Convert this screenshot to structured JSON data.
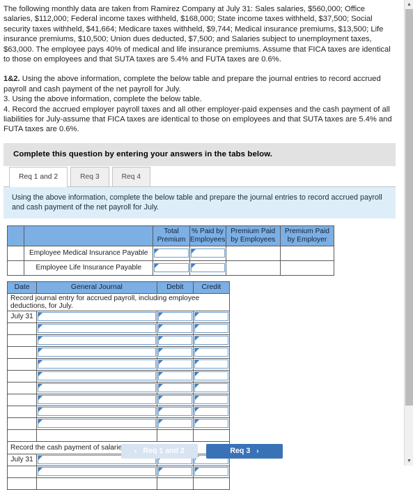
{
  "problem": {
    "paragraph": "The following monthly data are taken from Ramirez Company at July 31: Sales salaries, $560,000; Office salaries, $112,000; Federal income taxes withheld, $168,000; State income taxes withheld, $37,500; Social security taxes withheld, $41,664; Medicare taxes withheld, $9,744; Medical insurance premiums, $13,500; Life insurance premiums, $10,500; Union dues deducted, $7,500; and Salaries subject to unemployment taxes, $63,000. The employee pays 40% of medical and life insurance premiums. Assume that FICA taxes are identical to those on employees and that SUTA taxes are 5.4% and FUTA taxes are 0.6%.",
    "req_1_2_label": "1&2.",
    "req_1_2_text": " Using the above information, complete the below table and prepare the journal entries to record accrued payroll and cash payment of the net payroll for July.",
    "req_3": "3. Using the above information, complete the below table.",
    "req_4": "4. Record the accrued employer payroll taxes and all other employer-paid expenses and the cash payment of all liabilities for July-assume that FICA taxes are identical to those on employees and that SUTA taxes are 5.4% and FUTA taxes are 0.6%."
  },
  "banner": {
    "text": "Complete this question by entering your answers in the tabs below."
  },
  "tabs": [
    {
      "label": "Req 1 and 2",
      "active": true
    },
    {
      "label": "Req 3",
      "active": false
    },
    {
      "label": "Req 4",
      "active": false
    }
  ],
  "bluebar": {
    "text": "Using the above information, complete the below table and prepare the journal entries to record accrued payroll and cash payment of the net payroll for July."
  },
  "premium_table": {
    "headers": [
      "",
      "",
      "Total Premium",
      "% Paid by Employees",
      "Premium Paid by Employees",
      "Premium Paid by Employer"
    ],
    "headers_line1": [
      "",
      "",
      "Total",
      "% Paid by",
      "Premium Paid",
      "Premium Paid"
    ],
    "headers_line2": [
      "",
      "",
      "Premium",
      "Employees",
      "by Employees",
      "by Employer"
    ],
    "rows": [
      {
        "label": "Employee Medical Insurance Payable",
        "total_premium": "",
        "pct_paid": "",
        "paid_by_employees": "",
        "paid_by_employer": ""
      },
      {
        "label": "Employee Life Insurance Payable",
        "total_premium": "",
        "pct_paid": "",
        "paid_by_employees": "",
        "paid_by_employer": ""
      }
    ]
  },
  "journal_table": {
    "headers": [
      "Date",
      "General Journal",
      "Debit",
      "Credit"
    ],
    "sections": [
      {
        "title": "Record journal entry for accrued payroll, including employee deductions, for July.",
        "rows": [
          {
            "date": "July 31",
            "account": "",
            "debit": "",
            "credit": ""
          },
          {
            "date": "",
            "account": "",
            "debit": "",
            "credit": ""
          },
          {
            "date": "",
            "account": "",
            "debit": "",
            "credit": ""
          },
          {
            "date": "",
            "account": "",
            "debit": "",
            "credit": ""
          },
          {
            "date": "",
            "account": "",
            "debit": "",
            "credit": ""
          },
          {
            "date": "",
            "account": "",
            "debit": "",
            "credit": ""
          },
          {
            "date": "",
            "account": "",
            "debit": "",
            "credit": ""
          },
          {
            "date": "",
            "account": "",
            "debit": "",
            "credit": ""
          },
          {
            "date": "",
            "account": "",
            "debit": "",
            "credit": ""
          },
          {
            "date": "",
            "account": "",
            "debit": "",
            "credit": ""
          }
        ]
      },
      {
        "title": "Record the cash payment of salaries.",
        "rows": [
          {
            "date": "July 31",
            "account": "",
            "debit": "",
            "credit": ""
          },
          {
            "date": "",
            "account": "",
            "debit": "",
            "credit": ""
          }
        ]
      }
    ]
  },
  "footer": {
    "prev_label": "Req 1 and 2",
    "prev_chevron": "‹",
    "next_label": "Req 3",
    "next_chevron": "›"
  },
  "scrollbar": {
    "up_arrow": "▲",
    "down_arrow": "▼"
  },
  "colors": {
    "header_blue": "#7cafe4",
    "bluebar_bg": "#ddeef8",
    "banner_bg": "#e2e2e2",
    "next_button": "#3a72b8",
    "prev_button": "#d8e4f1",
    "input_border": "#6d9ed0"
  }
}
